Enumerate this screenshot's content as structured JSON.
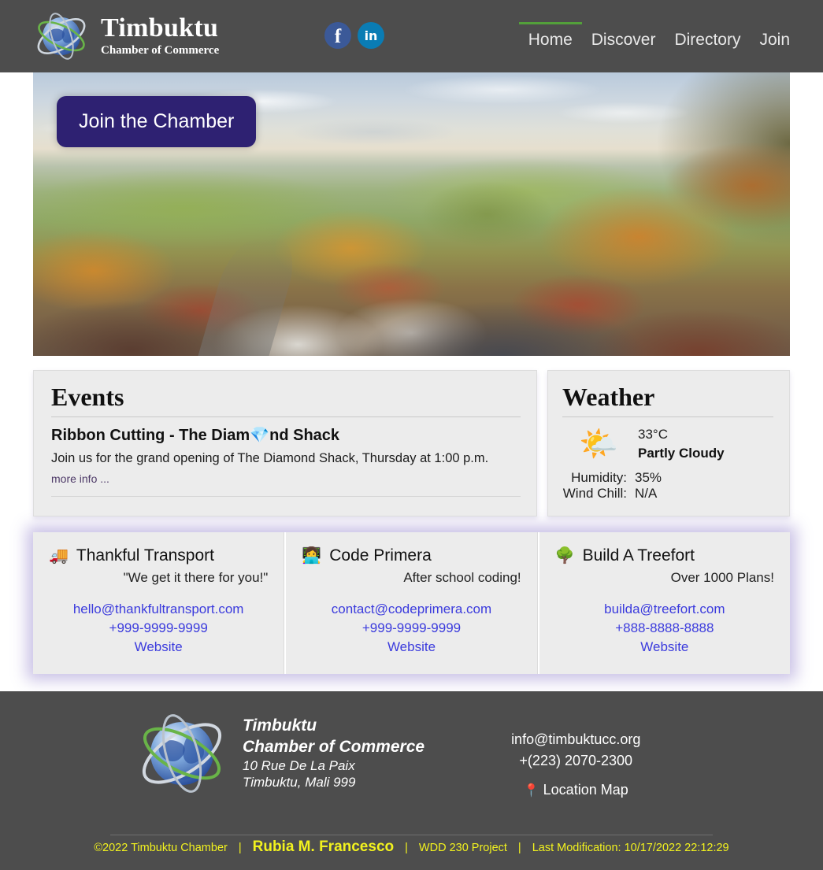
{
  "header": {
    "logo_icon": "globe-logo",
    "brand_title": "Timbuktu",
    "brand_subtitle": "Chamber of Commerce",
    "social": [
      {
        "name": "facebook-icon",
        "glyph": "f"
      },
      {
        "name": "linkedin-icon",
        "glyph": "in"
      }
    ],
    "nav": [
      {
        "label": "Home",
        "active": true
      },
      {
        "label": "Discover",
        "active": false
      },
      {
        "label": "Directory",
        "active": false
      },
      {
        "label": "Join",
        "active": false
      }
    ],
    "bg_color": "#4d4d4d",
    "active_underline_color": "#53a03a"
  },
  "hero": {
    "cta_label": "Join the Chamber",
    "cta_color": "#2e2172",
    "image_alt": "Aerial view of an autumn village in a valley"
  },
  "events": {
    "title": "Events",
    "item": {
      "title_prefix": "Ribbon Cutting - ",
      "title_rest_a": "The Diam",
      "title_emoji": "💎",
      "title_rest_b": "nd Shack",
      "description": "Join us for the grand opening of The Diamond Shack, Thursday at 1:00 p.m.",
      "more_label": "more info ..."
    }
  },
  "weather": {
    "title": "Weather",
    "icon": "sun-behind-cloud-icon",
    "icon_glyph": "🌤️",
    "temperature": "33°C",
    "condition": "Partly Cloudy",
    "rows": [
      {
        "label": "Humidity:",
        "value": "35%"
      },
      {
        "label": "Wind Chill:",
        "value": "N/A"
      }
    ]
  },
  "businesses": [
    {
      "emoji": "🚚",
      "icon_name": "truck-icon",
      "name": "Thankful Transport",
      "tagline": "\"We get it there for you!\"",
      "email": "hello@thankfultransport.com",
      "phone": "+999-9999-9999",
      "website_label": "Website"
    },
    {
      "emoji": "👩‍💻",
      "icon_name": "technologist-icon",
      "name": "Code Primera",
      "tagline": "After school coding!",
      "email": "contact@codeprimera.com",
      "phone": "+999-9999-9999",
      "website_label": "Website"
    },
    {
      "emoji": "🌳",
      "icon_name": "tree-icon",
      "name": "Build A Treefort",
      "tagline": "Over 1000 Plans!",
      "email": "builda@treefort.com",
      "phone": "+888-8888-8888",
      "website_label": "Website"
    }
  ],
  "footer": {
    "logo_icon": "globe-logo",
    "brand_line1": "Timbuktu",
    "brand_line2": "Chamber of Commerce",
    "address_line1": "10 Rue De La Paix",
    "address_line2": "Timbuktu, Mali 999",
    "email": "info@timbuktucc.org",
    "phone": "+(223) 2070-2300",
    "map_emoji": "📍",
    "map_label": "Location Map",
    "bg_color": "#4d4d4d",
    "copyright": "©2022 Timbuktu Chamber",
    "separator": "|",
    "author": "Rubia M. Francesco",
    "project": "WDD 230 Project",
    "last_modification": "Last Modification: 10/17/2022 22:12:29",
    "text_color": "#f2f21e"
  }
}
